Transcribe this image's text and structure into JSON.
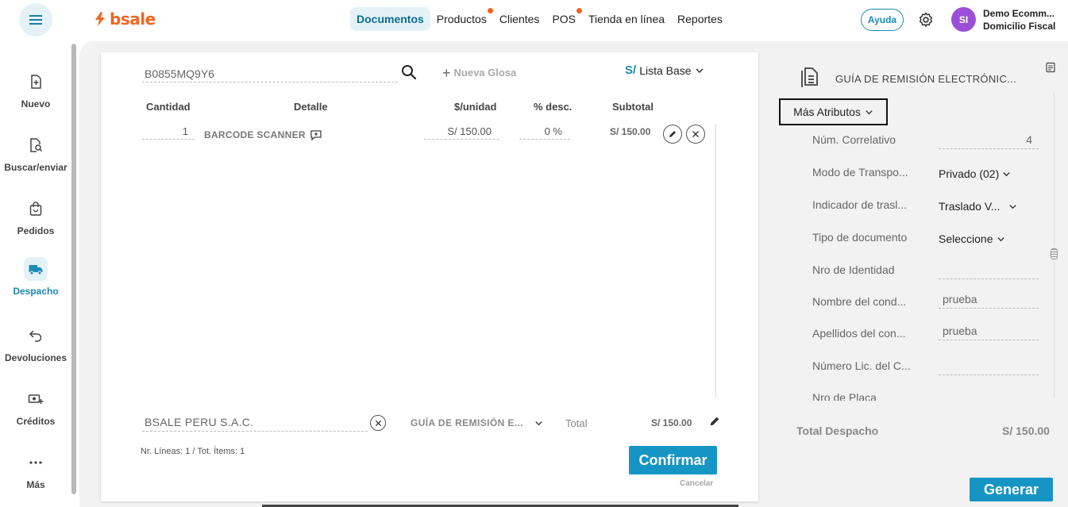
{
  "topbar": {
    "logo": "bsale",
    "nav": [
      {
        "label": "Documentos",
        "active": true,
        "dot": false
      },
      {
        "label": "Productos",
        "active": false,
        "dot": true
      },
      {
        "label": "Clientes",
        "active": false,
        "dot": false
      },
      {
        "label": "POS",
        "active": false,
        "dot": true
      },
      {
        "label": "Tienda en línea",
        "active": false,
        "dot": false
      },
      {
        "label": "Reportes",
        "active": false,
        "dot": false
      }
    ],
    "help_label": "Ayuda",
    "avatar_initials": "SI",
    "account_name": "Demo Ecomm...",
    "account_sub": "Domicilio Fiscal"
  },
  "sidebar": {
    "items": [
      {
        "label": "Nuevo",
        "icon": "file-plus-icon"
      },
      {
        "label": "Buscar/enviar",
        "icon": "file-search-icon"
      },
      {
        "label": "Pedidos",
        "icon": "shopping-bag-icon"
      },
      {
        "label": "Despacho",
        "icon": "truck-icon",
        "active": true
      },
      {
        "label": "Devoluciones",
        "icon": "return-arrow-icon"
      },
      {
        "label": "Créditos",
        "icon": "money-plus-icon"
      },
      {
        "label": "Más",
        "icon": "more-dots-icon"
      }
    ]
  },
  "document": {
    "search_value": "B0855MQ9Y6",
    "new_gloss_label": "Nueva Glosa",
    "currency_symbol": "S/",
    "price_list": "Lista Base",
    "columns": {
      "qty": "Cantidad",
      "detail": "Detalle",
      "unit_price": "$/unidad",
      "discount": "% desc.",
      "subtotal": "Subtotal"
    },
    "lines": [
      {
        "qty": "1",
        "name": "BARCODE SCANNER",
        "unit_price": "S/ 150.00",
        "discount": "0 %",
        "subtotal": "S/ 150.00"
      }
    ],
    "client": "BSALE PERU S.A.C.",
    "doc_type": "GUÍA DE REMISIÓN E...",
    "total_label": "Total",
    "total_value": "S/ 150.00",
    "lines_info": "Nr. Líneas: 1 / Tot. Ítems: 1",
    "confirm_label": "Confirmar",
    "cancel_label": "Cancelar"
  },
  "panel": {
    "title": "GUÍA DE REMISIÓN ELECTRÓNIC...",
    "more_attrs_label": "Más Atributos",
    "attrs": [
      {
        "label": "Núm. Correlativo",
        "value": "4",
        "kind": "input-right"
      },
      {
        "label": "Modo de Transpo...",
        "value": "Privado (02)",
        "kind": "select"
      },
      {
        "label": "Indicador de trasl...",
        "value": "Traslado V...",
        "kind": "select"
      },
      {
        "label": "Tipo de documento",
        "value": "Seleccione",
        "kind": "select"
      },
      {
        "label": "Nro de Identidad",
        "value": "",
        "kind": "input"
      },
      {
        "label": "Nombre del cond...",
        "value": "prueba",
        "kind": "input"
      },
      {
        "label": "Apellidos del con...",
        "value": "prueba",
        "kind": "input"
      },
      {
        "label": "Número Lic. del C...",
        "value": "",
        "kind": "input"
      },
      {
        "label": "Nro de Placa",
        "value": "",
        "kind": "input"
      }
    ],
    "total_label": "Total Despacho",
    "total_value": "S/ 150.00",
    "generate_label": "Generar"
  },
  "colors": {
    "brand": "#f26522",
    "accent": "#1695c5",
    "avatar": "#9b4fd6"
  }
}
